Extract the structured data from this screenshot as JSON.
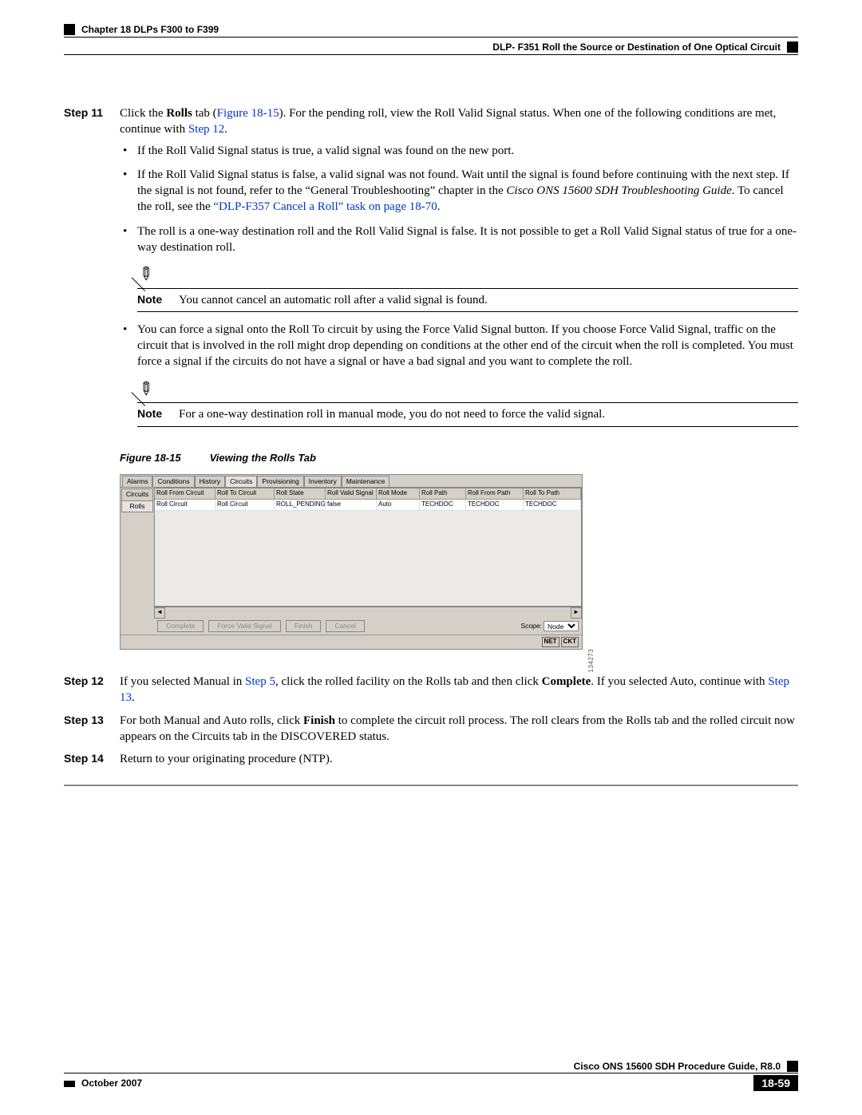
{
  "header": {
    "chapter": "Chapter 18      DLPs F300 to F399",
    "section": "DLP- F351 Roll the Source or Destination of One Optical Circuit"
  },
  "steps": {
    "s11": {
      "label": "Step 11",
      "p1_a": "Click the ",
      "p1_b": "Rolls",
      "p1_c": " tab (",
      "p1_link": "Figure 18-15",
      "p1_d": "). For the pending roll, view the Roll Valid Signal status. When one of the following conditions are met, continue with ",
      "p1_link2": "Step 12",
      "p1_e": ".",
      "b1": "If the Roll Valid Signal status is true, a valid signal was found on the new port.",
      "b2_a": "If the Roll Valid Signal status is false, a valid signal was not found. Wait until the signal is found before continuing with the next step. If the signal is not found, refer to the “General Troubleshooting” chapter in the ",
      "b2_ital": "Cisco ONS 15600 SDH Troubleshooting Guide",
      "b2_b": ". To cancel the roll, see the ",
      "b2_link": "“DLP-F357 Cancel a Roll” task on page 18-70",
      "b2_c": ".",
      "b3": "The roll is a one-way destination roll and the Roll Valid Signal is false. It is not possible to get a Roll Valid Signal status of true for a one-way destination roll.",
      "note1_label": "Note",
      "note1_text": "You cannot cancel an automatic roll after a valid signal is found.",
      "b4": "You can force a signal onto the Roll To circuit by using the Force Valid Signal button. If you choose Force Valid Signal, traffic on the circuit that is involved in the roll might drop depending on conditions at the other end of the circuit when the roll is completed. You must force a signal if the circuits do not have a signal or have a bad signal and you want to complete the roll.",
      "note2_label": "Note",
      "note2_text": "For a one-way destination roll in manual mode, you do not need to force the valid signal."
    },
    "s12": {
      "label": "Step 12",
      "a": "If you selected Manual in ",
      "link": "Step 5",
      "b": ", click the rolled facility on the Rolls tab and then click ",
      "bold": "Complete",
      "c": ". If you selected Auto, continue with ",
      "link2": "Step 13",
      "d": "."
    },
    "s13": {
      "label": "Step 13",
      "a": "For both Manual and Auto rolls, click ",
      "bold": "Finish",
      "b": " to complete the circuit roll process. The roll clears from the Rolls tab and the rolled circuit now appears on the Circuits tab in the DISCOVERED status."
    },
    "s14": {
      "label": "Step 14",
      "text": "Return to your originating procedure (NTP)."
    }
  },
  "figure": {
    "caption_num": "Figure 18-15",
    "caption_title": "Viewing the Rolls Tab",
    "tabs": [
      "Alarms",
      "Conditions",
      "History",
      "Circuits",
      "Provisioning",
      "Inventory",
      "Maintenance"
    ],
    "side_tabs": [
      "Circuits",
      "Rolls"
    ],
    "columns": [
      "Roll From Circuit",
      "Roll To Circuit",
      "Roll State",
      "Roll Valid Signal",
      "Roll Mode",
      "Roll Path",
      "Roll From Path",
      "Roll To Path"
    ],
    "row": [
      "Roll Circuit",
      "Roll Circuit",
      "ROLL_PENDING",
      "false",
      "Auto",
      "TECHDOC",
      "TECHDOC",
      "TECHDOC"
    ],
    "buttons": [
      "Complete",
      "Force Valid Signal",
      "Finish",
      "Cancel"
    ],
    "scope_label": "Scope:",
    "scope_value": "Node",
    "net": "NET",
    "ckt": "CKT",
    "img_id": "134273"
  },
  "footer": {
    "guide": "Cisco ONS 15600 SDH Procedure Guide, R8.0",
    "date": "October 2007",
    "page": "18-59"
  }
}
